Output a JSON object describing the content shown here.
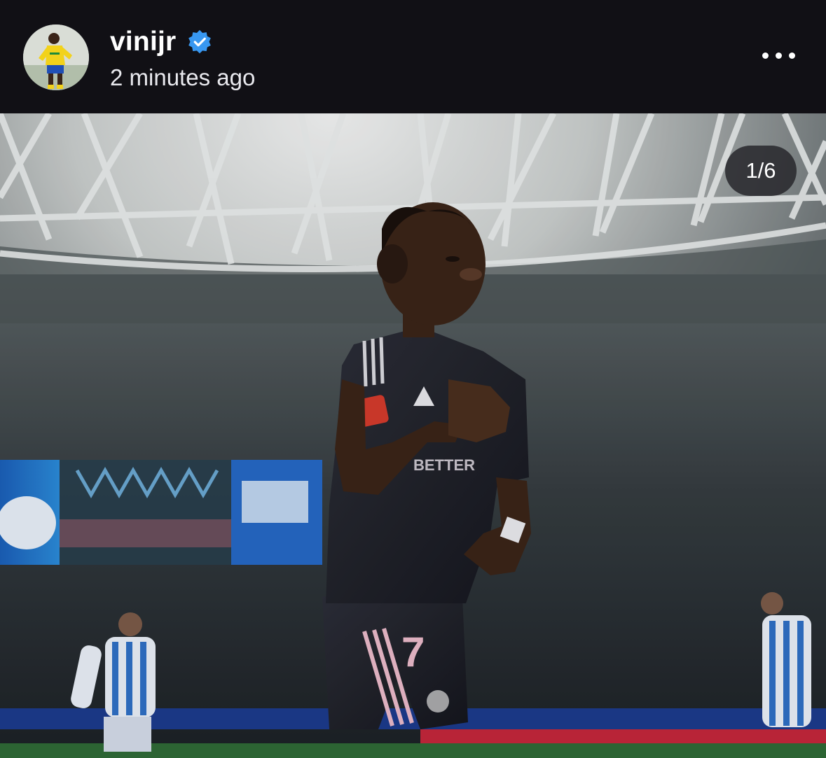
{
  "post": {
    "username": "vinijr",
    "verified": true,
    "timestamp": "2 minutes ago",
    "more_icon": "more-horizontal-icon",
    "avatar_icon": "profile-avatar",
    "media_counter": "1/6"
  },
  "colors": {
    "header_bg": "#111015",
    "verified_blue": "#3897f0",
    "counter_bg": "#28282c"
  }
}
